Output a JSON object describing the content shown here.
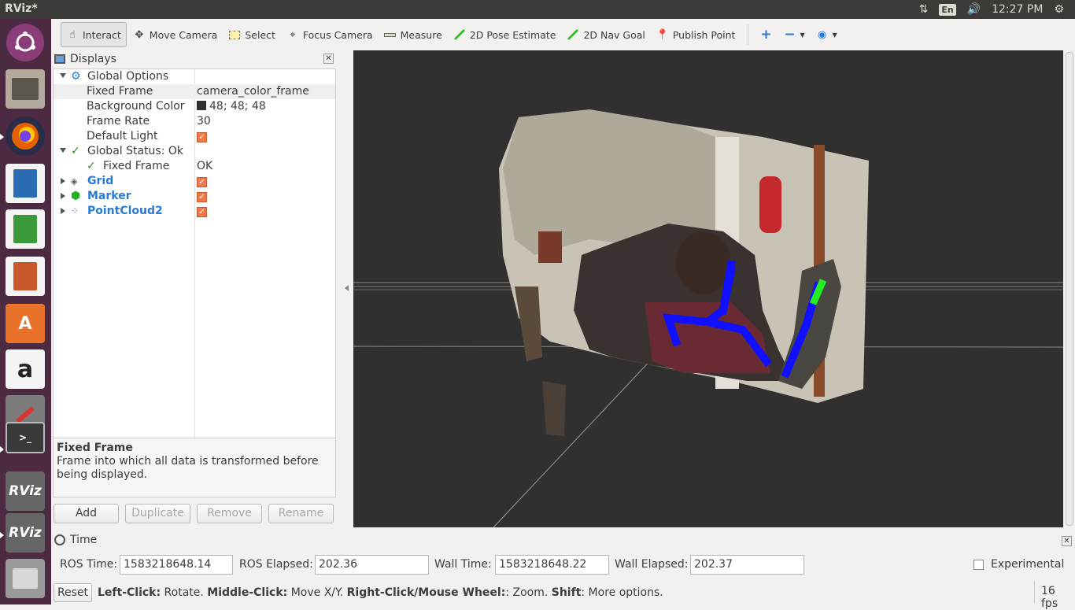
{
  "window": {
    "title": "RViz*"
  },
  "tray": {
    "lang": "En",
    "clock": "12:27 PM"
  },
  "launcher": {
    "items": [
      {
        "name": "ubuntu-dash-icon",
        "label": ""
      },
      {
        "name": "files-icon",
        "label": ""
      },
      {
        "name": "firefox-icon",
        "label": ""
      },
      {
        "name": "writer-icon",
        "label": ""
      },
      {
        "name": "calc-icon",
        "label": ""
      },
      {
        "name": "impress-icon",
        "label": ""
      },
      {
        "name": "software-center-icon",
        "label": "A"
      },
      {
        "name": "amazon-icon",
        "label": "a"
      },
      {
        "name": "system-settings-icon",
        "label": ""
      },
      {
        "name": "terminal-icon",
        "label": ""
      },
      {
        "name": "rviz-icon",
        "label": "RViz"
      },
      {
        "name": "rviz-icon",
        "label": "RViz"
      },
      {
        "name": "trash-icon",
        "label": ""
      }
    ]
  },
  "toolbar": {
    "tools": [
      {
        "label": "Interact",
        "icon": "hand-icon"
      },
      {
        "label": "Move Camera",
        "icon": "move-camera-icon"
      },
      {
        "label": "Select",
        "icon": "select-icon"
      },
      {
        "label": "Focus Camera",
        "icon": "focus-camera-icon"
      },
      {
        "label": "Measure",
        "icon": "ruler-icon"
      },
      {
        "label": "2D Pose Estimate",
        "icon": "green-arrow-icon"
      },
      {
        "label": "2D Nav Goal",
        "icon": "green-arrow-icon"
      },
      {
        "label": "Publish Point",
        "icon": "map-pin-icon"
      }
    ]
  },
  "displays": {
    "title": "Displays",
    "rows": [
      {
        "key": "Global Options",
        "value": ""
      },
      {
        "key": "Fixed Frame",
        "value": "camera_color_frame"
      },
      {
        "key": "Background Color",
        "value": "48; 48; 48"
      },
      {
        "key": "Frame Rate",
        "value": "30"
      },
      {
        "key": "Default Light",
        "value": ""
      },
      {
        "key": "Global Status: Ok",
        "value": ""
      },
      {
        "key": "Fixed Frame",
        "value": "OK"
      },
      {
        "key": "Grid",
        "value": ""
      },
      {
        "key": "Marker",
        "value": ""
      },
      {
        "key": "PointCloud2",
        "value": ""
      }
    ],
    "description": {
      "title": "Fixed Frame",
      "text": "Frame into which all data is transformed before being displayed."
    },
    "buttons": {
      "add": "Add",
      "duplicate": "Duplicate",
      "remove": "Remove",
      "rename": "Rename"
    }
  },
  "time": {
    "title": "Time",
    "ros_time_label": "ROS Time:",
    "ros_time": "1583218648.14",
    "ros_elapsed_label": "ROS Elapsed:",
    "ros_elapsed": "202.36",
    "wall_time_label": "Wall Time:",
    "wall_time": "1583218648.22",
    "wall_elapsed_label": "Wall Elapsed:",
    "wall_elapsed": "202.37",
    "experimental_label": "Experimental"
  },
  "status": {
    "reset": "Reset",
    "b1": "Left-Click:",
    "t1": " Rotate. ",
    "b2": "Middle-Click:",
    "t2": " Move X/Y. ",
    "b3": "Right-Click/Mouse Wheel:",
    "t3": ": Zoom. ",
    "b4": "Shift",
    "t4": ": More options.",
    "fps": "16 fps"
  }
}
